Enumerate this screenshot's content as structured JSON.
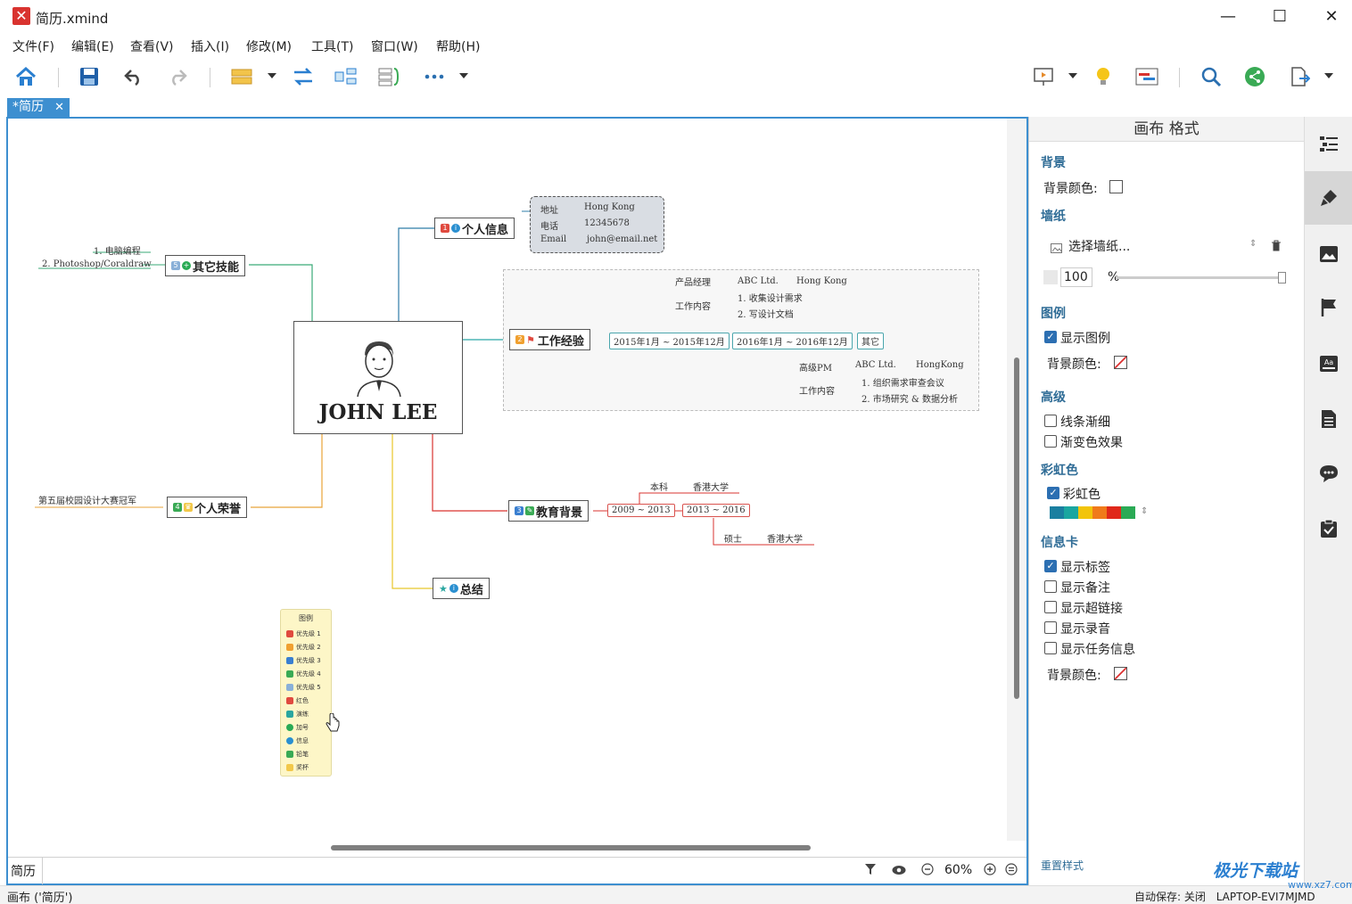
{
  "window": {
    "title": "简历.xmind",
    "minimize": "—",
    "maximize": "☐",
    "close": "✕"
  },
  "menu": [
    "文件(F)",
    "编辑(E)",
    "查看(V)",
    "插入(I)",
    "修改(M)",
    "工具(T)",
    "窗口(W)",
    "帮助(H)"
  ],
  "tab": {
    "label": "*简历",
    "close": "✕"
  },
  "map": {
    "central": "JOHN LEE",
    "personal_info": {
      "label": "个人信息",
      "rows": [
        {
          "key": "地址",
          "value": "Hong Kong"
        },
        {
          "key": "电话",
          "value": "12345678"
        },
        {
          "key": "Email",
          "value": "john@email.net"
        }
      ]
    },
    "other_skills": {
      "label": "其它技能",
      "items": [
        "1. 电脑编程",
        "2. Photoshop/Coraldraw"
      ]
    },
    "work": {
      "label": "工作经验",
      "period1": "2015年1月 ~ 2015年12月",
      "period2": "2016年1月 ~ 2016年12月",
      "other": "其它",
      "p1_role": "产品经理",
      "p1_company": "ABC Ltd.",
      "p1_place": "Hong Kong",
      "p1_content": "工作内容",
      "p1_tasks": [
        "1. 收集设计需求",
        "2. 写设计文档"
      ],
      "p2_role": "高级PM",
      "p2_company": "ABC Ltd.",
      "p2_place": "HongKong",
      "p2_content": "工作内容",
      "p2_tasks": [
        "1. 组织需求审查会议",
        "2. 市场研究 & 数据分析"
      ]
    },
    "honors": {
      "label": "个人荣誉",
      "item": "第五届校园设计大赛冠军"
    },
    "education": {
      "label": "教育背景",
      "period1": "2009 ~ 2013",
      "period2": "2013 ~ 2016",
      "degree1": "本科",
      "school1": "香港大学",
      "degree2": "硕士",
      "school2": "香港大学"
    },
    "summary": {
      "label": "总结"
    }
  },
  "legend": {
    "title": "图例",
    "items": [
      {
        "label": "优先级 1",
        "color": "#e04a3f"
      },
      {
        "label": "优先级 2",
        "color": "#f0a030"
      },
      {
        "label": "优先级 3",
        "color": "#3a7fd0"
      },
      {
        "label": "优先级 4",
        "color": "#3aaa55"
      },
      {
        "label": "优先级 5",
        "color": "#8ab0d8"
      },
      {
        "label": "红色",
        "color": "#e04a3f"
      },
      {
        "label": "演练",
        "color": "#2aa6a0"
      },
      {
        "label": "加号",
        "color": "#2aaa55"
      },
      {
        "label": "信息",
        "color": "#2a8fd0"
      },
      {
        "label": "铅笔",
        "color": "#3aaa55"
      },
      {
        "label": "奖杯",
        "color": "#f2c84a"
      }
    ]
  },
  "bottombar": {
    "sheet": "简历",
    "zoom": "60%"
  },
  "panel": {
    "title": "画布 格式",
    "bg_section": "背景",
    "bg_color_label": "背景颜色:",
    "wallpaper_section": "墙纸",
    "wallpaper_select": "选择墙纸...",
    "opacity_value": "100",
    "opacity_unit": "%",
    "legend_section": "图例",
    "show_legend": "显示图例",
    "legend_bg_label": "背景颜色:",
    "advanced_section": "高级",
    "taper_lines": "线条渐细",
    "gradient": "渐变色效果",
    "rainbow_section": "彩虹色",
    "rainbow_label": "彩虹色",
    "rainbow_colors": [
      "#1a7fa0",
      "#1aa6a0",
      "#f2c40a",
      "#f07a1a",
      "#e0281a",
      "#2aaa55"
    ],
    "infocard_section": "信息卡",
    "show_labels": "显示标签",
    "show_notes": "显示备注",
    "show_links": "显示超链接",
    "show_audio": "显示录音",
    "show_tasks": "显示任务信息",
    "infocard_bg_label": "背景颜色:",
    "reset": "重置样式"
  },
  "status": {
    "left": "画布 ('简历')",
    "autosave": "自动保存: 关闭",
    "device": "LAPTOP-EVI7MJMD"
  },
  "watermark": {
    "main": "极光下载站",
    "sub": "www.xz7.com"
  }
}
